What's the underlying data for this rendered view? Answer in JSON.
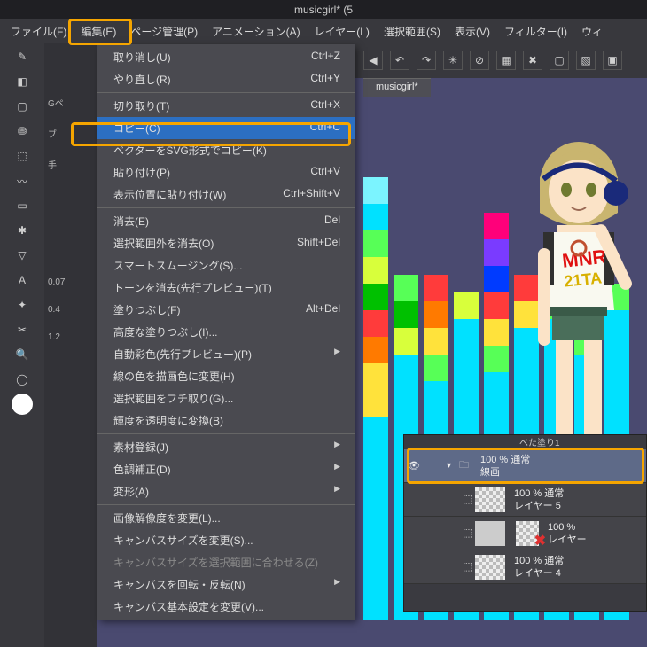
{
  "titlebar": "musicgirl* (5",
  "menubar": {
    "file": "ファイル(F)",
    "edit": "編集(E)",
    "page": "ページ管理(P)",
    "anim": "アニメーション(A)",
    "layer": "レイヤー(L)",
    "select": "選択範囲(S)",
    "view": "表示(V)",
    "filter": "フィルター(I)",
    "window": "ウィ"
  },
  "doc_tab": "musicgirl*",
  "edit_menu": {
    "undo": {
      "label": "取り消し(U)",
      "shortcut": "Ctrl+Z"
    },
    "redo": {
      "label": "やり直し(R)",
      "shortcut": "Ctrl+Y"
    },
    "cut": {
      "label": "切り取り(T)",
      "shortcut": "Ctrl+X"
    },
    "copy": {
      "label": "コピー(C)",
      "shortcut": "Ctrl+C"
    },
    "copysvg": {
      "label": "ベクターをSVG形式でコピー(K)"
    },
    "paste": {
      "label": "貼り付け(P)",
      "shortcut": "Ctrl+V"
    },
    "pasteat": {
      "label": "表示位置に貼り付け(W)",
      "shortcut": "Ctrl+Shift+V"
    },
    "erase": {
      "label": "消去(E)",
      "shortcut": "Del"
    },
    "eraseout": {
      "label": "選択範囲外を消去(O)",
      "shortcut": "Shift+Del"
    },
    "smooth": {
      "label": "スマートスムージング(S)..."
    },
    "tone": {
      "label": "トーンを消去(先行プレビュー)(T)"
    },
    "fill": {
      "label": "塗りつぶし(F)",
      "shortcut": "Alt+Del"
    },
    "advfill": {
      "label": "高度な塗りつぶし(I)..."
    },
    "autocolor": {
      "label": "自動彩色(先行プレビュー)(P)"
    },
    "linecol": {
      "label": "線の色を描画色に変更(H)"
    },
    "selout": {
      "label": "選択範囲をフチ取り(G)..."
    },
    "bright": {
      "label": "輝度を透明度に変換(B)"
    },
    "material": {
      "label": "素材登録(J)"
    },
    "colorcor": {
      "label": "色調補正(D)"
    },
    "trans": {
      "label": "変形(A)"
    },
    "imgres": {
      "label": "画像解像度を変更(L)..."
    },
    "canvsz": {
      "label": "キャンバスサイズを変更(S)..."
    },
    "canvsel": {
      "label": "キャンバスサイズを選択範囲に合わせる(Z)"
    },
    "canvrot": {
      "label": "キャンバスを回転・反転(N)"
    },
    "canvset": {
      "label": "キャンバス基本設定を変更(V)..."
    }
  },
  "props": {
    "gpen": "Gペ",
    "bl": "ブ",
    "te": "手",
    "v1": "0.07",
    "v2": "0.4",
    "v3": "1.2"
  },
  "layers": {
    "head": "べた塗り1",
    "group": {
      "opacity": "100 % 通常",
      "name": "線画"
    },
    "l5": {
      "opacity": "100 % 通常",
      "name": "レイヤー 5"
    },
    "lx": {
      "opacity": "100 %",
      "name": "レイヤー"
    },
    "l4": {
      "opacity": "100 % 通常",
      "name": "レイヤー 4"
    }
  },
  "colors": {
    "highlight": "#f5a500",
    "menu_select": "#2c6fc2"
  }
}
